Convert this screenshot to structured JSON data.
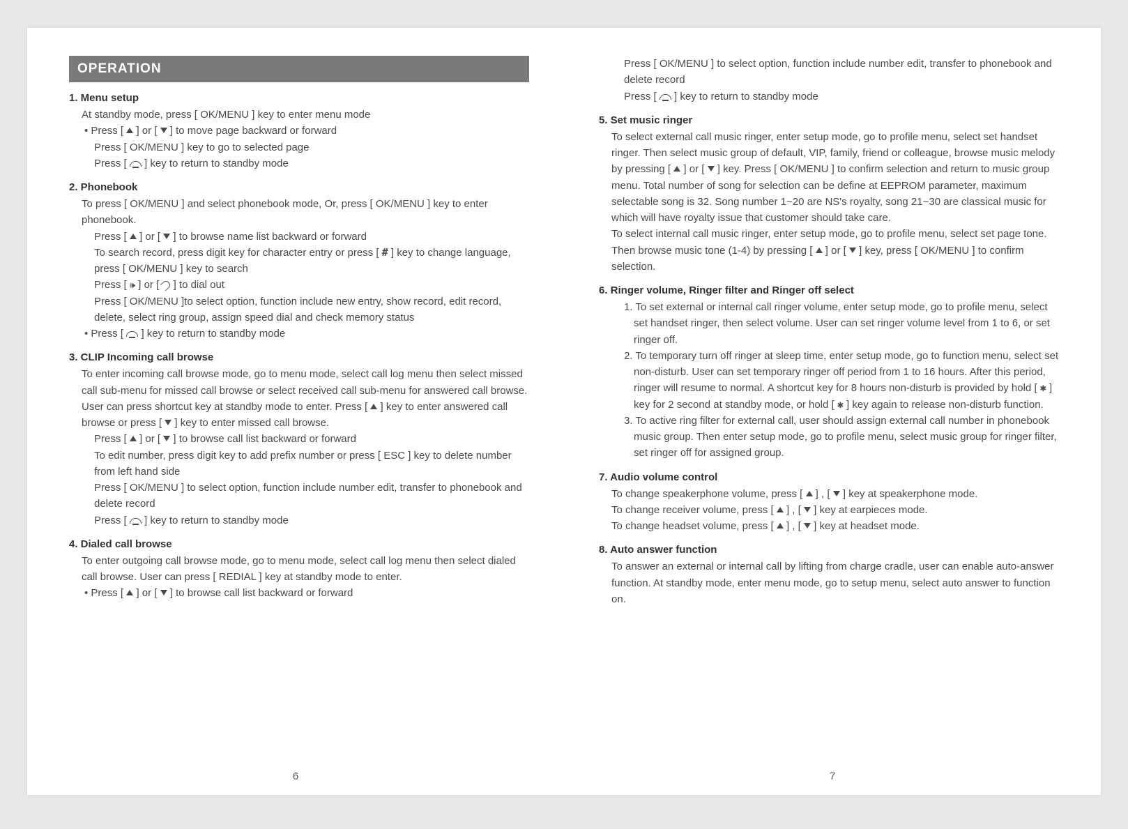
{
  "header": "OPERATION",
  "left": {
    "s1": {
      "title": "1. Menu setup",
      "intro": "At standby mode, press [ OK/MENU ] key to enter menu mode",
      "b1a": "Press [ ",
      "b1b": " ] or [ ",
      "b1c": " ] to move page backward or forward",
      "l2": "Press [ OK/MENU ] key to go to selected page",
      "l3a": "Press [ ",
      "l3b": " ] key to return to standby mode"
    },
    "s2": {
      "title": "2. Phonebook",
      "intro": "To press [ OK/MENU ] and select phonebook mode, Or, press [ OK/MENU ] key to enter phonebook.",
      "l1a": "Press [ ",
      "l1b": " ] or [ ",
      "l1c": " ] to browse name list backward or forward",
      "l2a": "To search record, press digit key for character entry or press [ ",
      "l2b": " ] key to change language, press [ OK/MENU ] key to search",
      "l3a": "Press [ ",
      "l3b": " ] or [ ",
      "l3c": " ] to dial out",
      "l4": "Press [ OK/MENU ]to select option, function include new entry, show record, edit record, delete, select ring group, assign speed dial and check memory status",
      "b1a": "Press [ ",
      "b1b": " ] key to return to standby mode"
    },
    "s3": {
      "title": "3. CLIP Incoming call browse",
      "introA": "To enter incoming call browse mode, go to menu mode, select call log menu then select missed call sub-menu for missed call browse or select received call sub-menu for answered call browse. User can press shortcut key at standby mode to enter. Press [ ",
      "introB": " ] key to enter answered call browse or press [ ",
      "introC": " ] key to enter missed call browse.",
      "l1a": "Press [ ",
      "l1b": " ] or [ ",
      "l1c": " ] to browse call list backward or forward",
      "l2": "To edit number, press digit key to add prefix number or press [ ESC ] key to delete number from left hand side",
      "l3": "Press [ OK/MENU ] to select option, function include number edit, transfer to phonebook and delete record",
      "l4a": "Press [ ",
      "l4b": " ] key to return to standby mode"
    },
    "s4": {
      "title": "4. Dialed call browse",
      "intro": "To enter outgoing call browse mode, go to menu mode, select call log menu then select dialed call browse. User can press [ REDIAL ] key at standby mode to enter.",
      "b1a": "Press [ ",
      "b1b": " ] or [ ",
      "b1c": " ] to browse call list backward or forward"
    },
    "pageNum": "6"
  },
  "right": {
    "cont": {
      "l1": "Press [ OK/MENU ] to select option, function include number edit, transfer to phonebook and delete record",
      "l2a": "Press [ ",
      "l2b": " ] key to return to standby mode"
    },
    "s5": {
      "title": "5. Set music ringer",
      "p1a": "To select external call music ringer, enter setup mode, go to profile menu, select set handset ringer. Then select music group of default, VIP, family, friend or colleague, browse music melody by pressing [ ",
      "p1b": " ] or [ ",
      "p1c": " ] key. Press [ OK/MENU ] to confirm selection and return to music group menu. Total number of song for selection can be define at EEPROM parameter, maximum selectable song is 32. Song number 1~20 are NS's royalty, song 21~30 are classical music for which will have royalty issue that customer should take care.",
      "p2a": "To select internal call music ringer, enter setup mode, go to profile menu, select set page tone. Then browse music tone (1-4) by pressing [ ",
      "p2b": " ] or [ ",
      "p2c": " ] key, press [ OK/MENU ] to confirm selection."
    },
    "s6": {
      "title": "6. Ringer volume, Ringer filter and Ringer off select",
      "i1": "1. To set external or internal call ringer volume, enter setup mode, go to profile menu, select set handset ringer, then select volume. User can set ringer volume level from 1 to 6, or set ringer off.",
      "i2a": "2. To temporary turn off ringer at sleep time, enter setup mode, go to function menu, select set non-disturb. User can set temporary ringer off period from 1 to 16 hours. After this period, ringer will resume to normal. A shortcut key for 8 hours non-disturb is provided by hold [ ",
      "i2b": " ] key for 2 second at standby mode, or hold [ ",
      "i2c": " ] key again to release non-disturb function.",
      "i3": "3. To active ring filter for external call, user should assign external call number in phonebook music group. Then enter setup mode, go to profile menu, select music group for ringer filter, set ringer off for assigned group."
    },
    "s7": {
      "title": "7. Audio volume control",
      "l1a": "To change speakerphone volume, press [ ",
      "l1b": " ] , [ ",
      "l1c": " ] key at speakerphone mode.",
      "l2a": "To change receiver volume, press [ ",
      "l2b": " ] , [ ",
      "l2c": " ] key at earpieces mode.",
      "l3a": "To change headset volume, press [ ",
      "l3b": " ] , [ ",
      "l3c": " ] key at headset mode."
    },
    "s8": {
      "title": "8. Auto answer function",
      "p": "To answer an external or internal call by lifting from charge cradle, user can enable auto-answer function. At standby mode, enter menu mode, go to setup menu, select auto answer to function on."
    },
    "pageNum": "7"
  }
}
